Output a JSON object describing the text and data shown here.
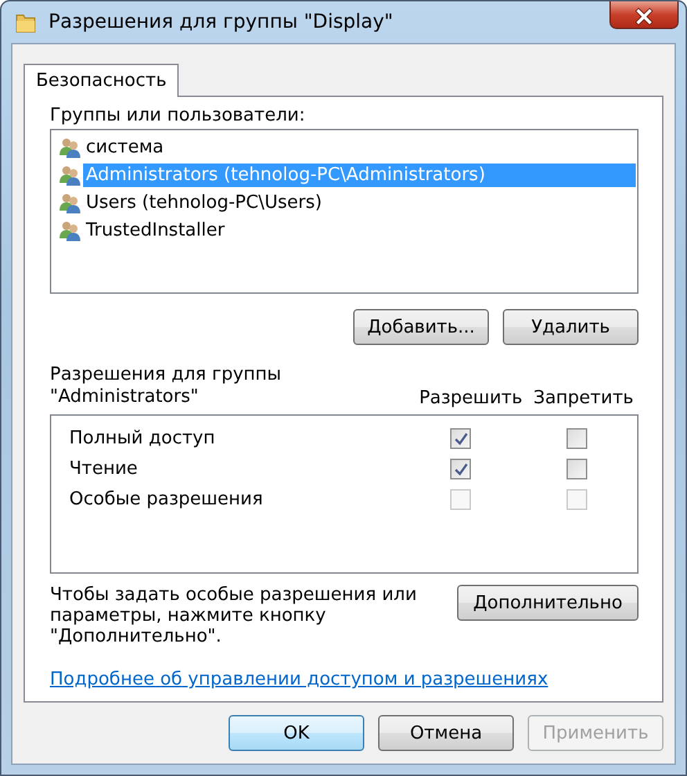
{
  "window": {
    "title": "Разрешения для группы \"Display\""
  },
  "tabs": [
    {
      "label": "Безопасность",
      "selected": true
    }
  ],
  "groups": {
    "label": "Группы или пользователи:",
    "items": [
      {
        "name": "система",
        "selected": false
      },
      {
        "name": "Administrators (tehnolog-PC\\Administrators)",
        "selected": true
      },
      {
        "name": "Users (tehnolog-PC\\Users)",
        "selected": false
      },
      {
        "name": "TrustedInstaller",
        "selected": false
      }
    ],
    "buttons": [
      {
        "label": "Добавить...",
        "disabled": false
      },
      {
        "label": "Удалить",
        "disabled": false
      }
    ]
  },
  "permissions": {
    "label": "Разрешения для группы \"Administrators\"",
    "columns": [
      "Разрешить",
      "Запретить"
    ],
    "rows": [
      {
        "name": "Полный доступ",
        "allow": {
          "checked": true,
          "disabled": false
        },
        "deny": {
          "checked": false,
          "disabled": false
        }
      },
      {
        "name": "Чтение",
        "allow": {
          "checked": true,
          "disabled": false
        },
        "deny": {
          "checked": false,
          "disabled": false
        }
      },
      {
        "name": "Особые разрешения",
        "allow": {
          "checked": false,
          "disabled": true
        },
        "deny": {
          "checked": false,
          "disabled": true
        }
      }
    ]
  },
  "advanced": {
    "note": "Чтобы задать особые разрешения или параметры, нажмите кнопку \"Дополнительно\".",
    "button": "Дополнительно"
  },
  "link": "Подробнее об управлении доступом и разрешениях",
  "buttons": [
    {
      "label": "OK",
      "default": true,
      "disabled": false
    },
    {
      "label": "Отмена",
      "default": false,
      "disabled": false
    },
    {
      "label": "Применить",
      "default": false,
      "disabled": true
    }
  ]
}
